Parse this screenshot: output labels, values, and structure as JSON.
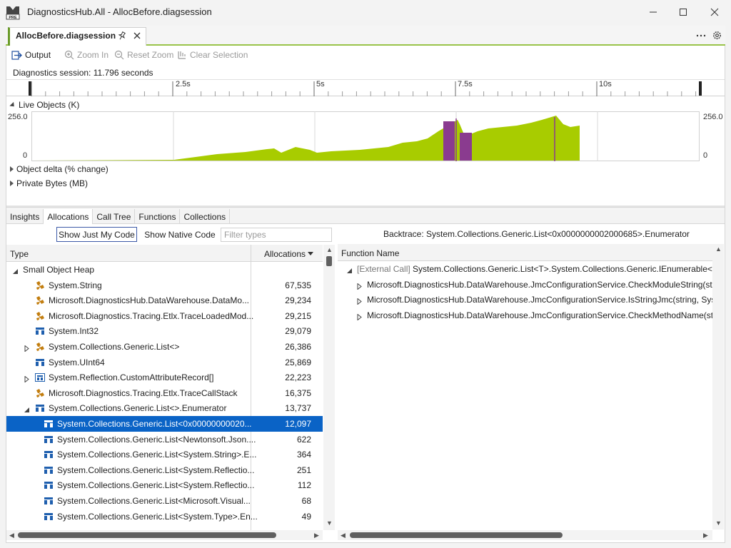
{
  "window": {
    "title": "DiagnosticsHub.All - AllocBefore.diagsession",
    "logo_badge": "PRE"
  },
  "document_tab": {
    "label": "AllocBefore.diagsession"
  },
  "toolbar": {
    "output_label": "Output",
    "zoom_in_label": "Zoom In",
    "reset_zoom_label": "Reset Zoom",
    "clear_selection_label": "Clear Selection"
  },
  "session": {
    "duration_text": "Diagnostics session: 11.796 seconds"
  },
  "timeline": {
    "ticks": [
      "2.5s",
      "5s",
      "7.5s",
      "10s"
    ]
  },
  "graphs": {
    "live_objects": {
      "label": "Live Objects (K)",
      "ymax_label": "256.0",
      "ymin_label": "0",
      "fill_color": "#a8cc00",
      "selection_color": "#8a3b8f"
    },
    "object_delta": {
      "label": "Object delta (% change)"
    },
    "private_bytes": {
      "label": "Private Bytes (MB)"
    }
  },
  "view_tabs": [
    "Insights",
    "Allocations",
    "Call Tree",
    "Functions",
    "Collections"
  ],
  "filters": {
    "just_my_code": "Show Just My Code",
    "native_code": "Show Native Code",
    "filter_placeholder": "Filter types"
  },
  "types_table": {
    "col_type": "Type",
    "col_allocations": "Allocations",
    "rows": [
      {
        "name": "Small Object Heap",
        "count": "",
        "level": 0,
        "expander": "down",
        "icon": "none"
      },
      {
        "name": "System.String",
        "count": "67,535",
        "level": 1,
        "expander": "none",
        "icon": "class-icon"
      },
      {
        "name": "Microsoft.DiagnosticsHub.DataWarehouse.DataMo...",
        "count": "29,234",
        "level": 1,
        "expander": "none",
        "icon": "class-icon"
      },
      {
        "name": "Microsoft.Diagnostics.Tracing.Etlx.TraceLoadedMod...",
        "count": "29,215",
        "level": 1,
        "expander": "none",
        "icon": "class-icon"
      },
      {
        "name": "System.Int32",
        "count": "29,079",
        "level": 1,
        "expander": "none",
        "icon": "struct-icon"
      },
      {
        "name": "System.Collections.Generic.List<>",
        "count": "26,386",
        "level": 1,
        "expander": "right",
        "icon": "class-icon"
      },
      {
        "name": "System.UInt64",
        "count": "25,869",
        "level": 1,
        "expander": "none",
        "icon": "struct-icon"
      },
      {
        "name": "System.Reflection.CustomAttributeRecord[]",
        "count": "22,223",
        "level": 1,
        "expander": "right",
        "icon": "array-icon"
      },
      {
        "name": "Microsoft.Diagnostics.Tracing.Etlx.TraceCallStack",
        "count": "16,375",
        "level": 1,
        "expander": "none",
        "icon": "class-icon"
      },
      {
        "name": "System.Collections.Generic.List<>.Enumerator",
        "count": "13,737",
        "level": 1,
        "expander": "down",
        "icon": "struct-icon"
      },
      {
        "name": "System.Collections.Generic.List<0x00000000020...",
        "count": "12,097",
        "level": 2,
        "expander": "none",
        "icon": "struct-icon",
        "selected": true
      },
      {
        "name": "System.Collections.Generic.List<Newtonsoft.Json....",
        "count": "622",
        "level": 2,
        "expander": "none",
        "icon": "struct-icon"
      },
      {
        "name": "System.Collections.Generic.List<System.String>.E...",
        "count": "364",
        "level": 2,
        "expander": "none",
        "icon": "struct-icon"
      },
      {
        "name": "System.Collections.Generic.List<System.Reflectio...",
        "count": "251",
        "level": 2,
        "expander": "none",
        "icon": "struct-icon"
      },
      {
        "name": "System.Collections.Generic.List<System.Reflectio...",
        "count": "112",
        "level": 2,
        "expander": "none",
        "icon": "struct-icon"
      },
      {
        "name": "System.Collections.Generic.List<Microsoft.Visual...",
        "count": "68",
        "level": 2,
        "expander": "none",
        "icon": "struct-icon"
      },
      {
        "name": "System.Collections.Generic.List<System.Type>.En...",
        "count": "49",
        "level": 2,
        "expander": "none",
        "icon": "struct-icon"
      }
    ]
  },
  "backtrace": {
    "title": "Backtrace: System.Collections.Generic.List<0x0000000002000685>.Enumerator",
    "col_function": "Function Name",
    "rows": [
      {
        "prefix": "[External Call] ",
        "name": "System.Collections.Generic.List<T>.System.Collections.Generic.IEnumerable<T>.",
        "level": 0,
        "expander": "down"
      },
      {
        "prefix": "",
        "name": "Microsoft.DiagnosticsHub.DataWarehouse.JmcConfigurationService.CheckModuleString(strin",
        "level": 1,
        "expander": "right"
      },
      {
        "prefix": "",
        "name": "Microsoft.DiagnosticsHub.DataWarehouse.JmcConfigurationService.IsStringJmc(string, Syste",
        "level": 1,
        "expander": "right"
      },
      {
        "prefix": "",
        "name": "Microsoft.DiagnosticsHub.DataWarehouse.JmcConfigurationService.CheckMethodName(strin",
        "level": 1,
        "expander": "right"
      }
    ]
  }
}
